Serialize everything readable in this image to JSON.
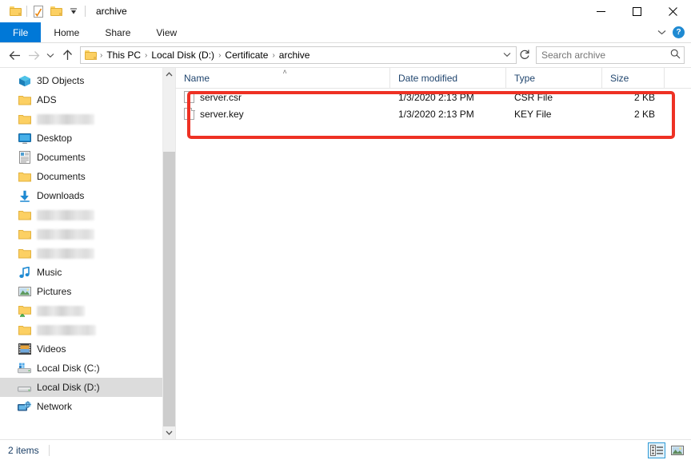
{
  "window": {
    "title": "archive",
    "controls": {
      "minimize": "─",
      "maximize": "□",
      "close": "✕"
    },
    "quick_access": [
      "folder-icon",
      "properties-icon",
      "new-folder-icon",
      "customize-chevron"
    ]
  },
  "ribbon": {
    "tabs": [
      {
        "label": "File",
        "active_file": true
      },
      {
        "label": "Home",
        "active_file": false
      },
      {
        "label": "Share",
        "active_file": false
      },
      {
        "label": "View",
        "active_file": false
      }
    ],
    "collapse_chevron": "⌄",
    "help_label": "?"
  },
  "address": {
    "back": "←",
    "forward": "→",
    "recent": "⌄",
    "up": "↑",
    "breadcrumbs": [
      "This PC",
      "Local Disk (D:)",
      "Certificate",
      "archive"
    ],
    "separator": "›",
    "dropdown": "⌄",
    "refresh": "↻"
  },
  "search": {
    "placeholder": "Search archive",
    "value": "",
    "icon": "⌕"
  },
  "sidebar": {
    "items": [
      {
        "label": "3D Objects",
        "icon": "3d-objects-icon",
        "blurred": false,
        "selected": false
      },
      {
        "label": "ADS",
        "icon": "folder-icon",
        "blurred": false,
        "selected": false
      },
      {
        "label": "",
        "icon": "folder-icon",
        "blurred": true,
        "selected": false,
        "blur_width": 72
      },
      {
        "label": "Desktop",
        "icon": "desktop-icon",
        "blurred": false,
        "selected": false
      },
      {
        "label": "Documents",
        "icon": "documents-library-icon",
        "blurred": false,
        "selected": false
      },
      {
        "label": "Documents",
        "icon": "folder-icon",
        "blurred": false,
        "selected": false
      },
      {
        "label": "Downloads",
        "icon": "downloads-icon",
        "blurred": false,
        "selected": false
      },
      {
        "label": "",
        "icon": "folder-icon",
        "blurred": true,
        "selected": false,
        "blur_width": 72
      },
      {
        "label": "",
        "icon": "folder-icon",
        "blurred": true,
        "selected": false,
        "blur_width": 72
      },
      {
        "label": "",
        "icon": "folder-icon",
        "blurred": true,
        "selected": false,
        "blur_width": 72
      },
      {
        "label": "Music",
        "icon": "music-icon",
        "blurred": false,
        "selected": false
      },
      {
        "label": "Pictures",
        "icon": "pictures-icon",
        "blurred": false,
        "selected": false
      },
      {
        "label": "",
        "icon": "shared-folder-icon",
        "blurred": true,
        "selected": false,
        "blur_width": 60
      },
      {
        "label": "",
        "icon": "folder-icon",
        "blurred": true,
        "selected": false,
        "blur_width": 74
      },
      {
        "label": "Videos",
        "icon": "videos-icon",
        "blurred": false,
        "selected": false
      },
      {
        "label": "Local Disk (C:)",
        "icon": "system-drive-icon",
        "blurred": false,
        "selected": false
      },
      {
        "label": "Local Disk (D:)",
        "icon": "drive-icon",
        "blurred": false,
        "selected": true
      },
      {
        "label": "Network",
        "icon": "network-icon",
        "blurred": false,
        "selected": false
      }
    ],
    "scroll_up": "˄",
    "scroll_down": "˅"
  },
  "filelist": {
    "columns": [
      {
        "label": "Name",
        "sorted": true,
        "sort_mark": "˄"
      },
      {
        "label": "Date modified",
        "sorted": false,
        "sort_mark": ""
      },
      {
        "label": "Type",
        "sorted": false,
        "sort_mark": ""
      },
      {
        "label": "Size",
        "sorted": false,
        "sort_mark": ""
      }
    ],
    "rows": [
      {
        "name": "server.csr",
        "date_modified": "1/3/2020 2:13 PM",
        "type": "CSR File",
        "size": "2 KB",
        "icon": "file-icon"
      },
      {
        "name": "server.key",
        "date_modified": "1/3/2020 2:13 PM",
        "type": "KEY File",
        "size": "2 KB",
        "icon": "file-icon"
      }
    ]
  },
  "annotation": {
    "color": "#ee3124",
    "shape": "rounded-rectangle",
    "target": "file-rows"
  },
  "statusbar": {
    "item_count": "2 items",
    "views": [
      {
        "name": "details-view",
        "active": true
      },
      {
        "name": "large-icons-view",
        "active": false
      }
    ]
  },
  "colors": {
    "accent": "#0078d7",
    "annotation": "#ee3124",
    "selection": "#dcdcdc",
    "header_text": "#20456e"
  }
}
